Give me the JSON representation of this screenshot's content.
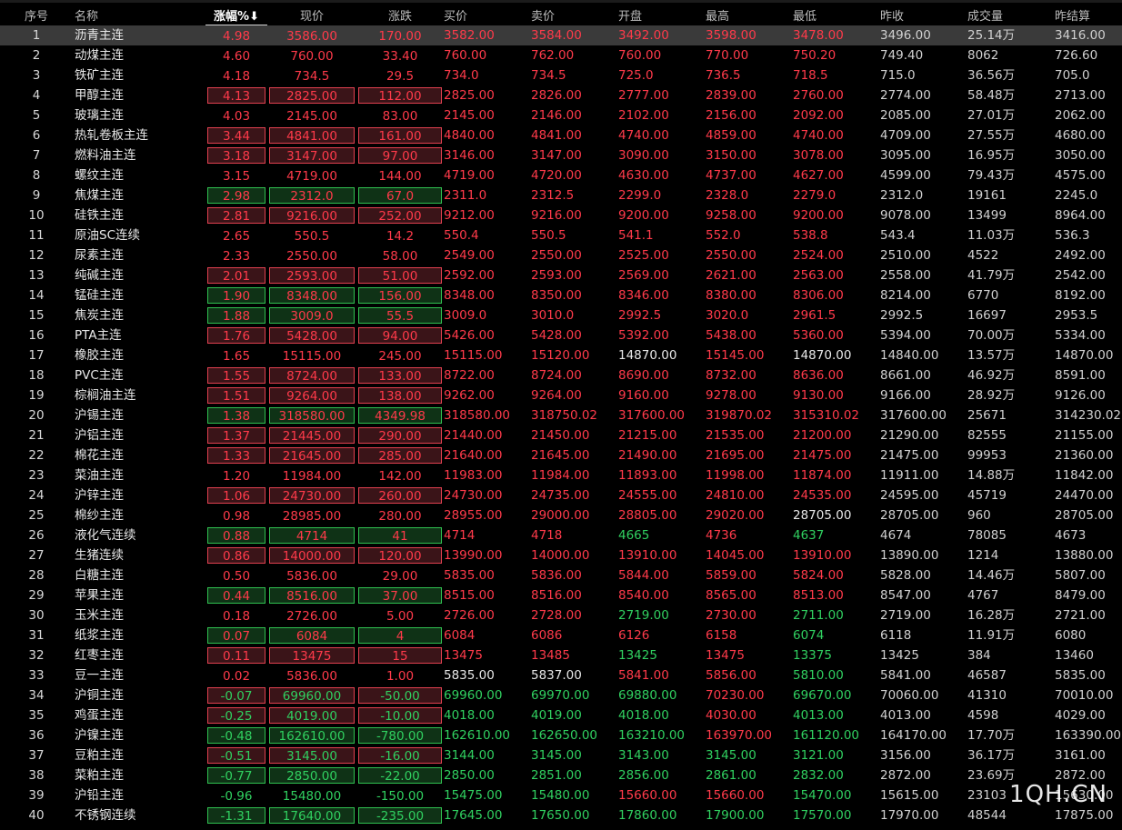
{
  "headers": [
    "序号",
    "名称",
    "涨幅%",
    "现价",
    "涨跌",
    "买价",
    "卖价",
    "开盘",
    "最高",
    "最低",
    "昨收",
    "成交量",
    "昨结算"
  ],
  "sort_arrow": "⬇",
  "colors": {
    "up": "#ff3a4a",
    "down": "#30d060",
    "flat": "#e8e8e8",
    "neutral": "#d0d0d0"
  },
  "watermark": "1QH.CN",
  "rows": [
    {
      "i": "1",
      "n": "沥青主连",
      "p": "4.98",
      "c": "3586.00",
      "d": "170.00",
      "b": "3582.00",
      "s": "3584.00",
      "o": "3492.00",
      "h": "3598.00",
      "l": "3478.00",
      "y": "3496.00",
      "v": "25.14万",
      "z": "3416.00",
      "box": "none",
      "cb": "up",
      "co": "up",
      "ch": "up",
      "cl": "up",
      "selected": true
    },
    {
      "i": "2",
      "n": "动煤主连",
      "p": "4.60",
      "c": "760.00",
      "d": "33.40",
      "b": "760.00",
      "s": "762.00",
      "o": "760.00",
      "h": "770.00",
      "l": "750.20",
      "y": "749.40",
      "v": "8062",
      "z": "726.60",
      "box": "none",
      "cb": "up",
      "co": "up",
      "ch": "up",
      "cl": "up"
    },
    {
      "i": "3",
      "n": "铁矿主连",
      "p": "4.18",
      "c": "734.5",
      "d": "29.5",
      "b": "734.0",
      "s": "734.5",
      "o": "725.0",
      "h": "736.5",
      "l": "718.5",
      "y": "715.0",
      "v": "36.56万",
      "z": "705.0",
      "box": "none",
      "cb": "up",
      "co": "up",
      "ch": "up",
      "cl": "up"
    },
    {
      "i": "4",
      "n": "甲醇主连",
      "p": "4.13",
      "c": "2825.00",
      "d": "112.00",
      "b": "2825.00",
      "s": "2826.00",
      "o": "2777.00",
      "h": "2839.00",
      "l": "2760.00",
      "y": "2774.00",
      "v": "58.48万",
      "z": "2713.00",
      "box": "red",
      "cb": "up",
      "co": "up",
      "ch": "up",
      "cl": "up"
    },
    {
      "i": "5",
      "n": "玻璃主连",
      "p": "4.03",
      "c": "2145.00",
      "d": "83.00",
      "b": "2145.00",
      "s": "2146.00",
      "o": "2102.00",
      "h": "2156.00",
      "l": "2092.00",
      "y": "2085.00",
      "v": "27.01万",
      "z": "2062.00",
      "box": "none",
      "cb": "up",
      "co": "up",
      "ch": "up",
      "cl": "up"
    },
    {
      "i": "6",
      "n": "热轧卷板主连",
      "p": "3.44",
      "c": "4841.00",
      "d": "161.00",
      "b": "4840.00",
      "s": "4841.00",
      "o": "4740.00",
      "h": "4859.00",
      "l": "4740.00",
      "y": "4709.00",
      "v": "27.55万",
      "z": "4680.00",
      "box": "red",
      "cb": "up",
      "co": "up",
      "ch": "up",
      "cl": "up"
    },
    {
      "i": "7",
      "n": "燃料油主连",
      "p": "3.18",
      "c": "3147.00",
      "d": "97.00",
      "b": "3146.00",
      "s": "3147.00",
      "o": "3090.00",
      "h": "3150.00",
      "l": "3078.00",
      "y": "3095.00",
      "v": "16.95万",
      "z": "3050.00",
      "box": "red",
      "cb": "up",
      "co": "up",
      "ch": "up",
      "cl": "up"
    },
    {
      "i": "8",
      "n": "螺纹主连",
      "p": "3.15",
      "c": "4719.00",
      "d": "144.00",
      "b": "4719.00",
      "s": "4720.00",
      "o": "4630.00",
      "h": "4737.00",
      "l": "4627.00",
      "y": "4599.00",
      "v": "79.43万",
      "z": "4575.00",
      "box": "none",
      "cb": "up",
      "co": "up",
      "ch": "up",
      "cl": "up"
    },
    {
      "i": "9",
      "n": "焦煤主连",
      "p": "2.98",
      "c": "2312.0",
      "d": "67.0",
      "b": "2311.0",
      "s": "2312.5",
      "o": "2299.0",
      "h": "2328.0",
      "l": "2279.0",
      "y": "2312.0",
      "v": "19161",
      "z": "2245.0",
      "box": "green",
      "cb": "up",
      "co": "up",
      "ch": "up",
      "cl": "up"
    },
    {
      "i": "10",
      "n": "硅铁主连",
      "p": "2.81",
      "c": "9216.00",
      "d": "252.00",
      "b": "9212.00",
      "s": "9216.00",
      "o": "9200.00",
      "h": "9258.00",
      "l": "9200.00",
      "y": "9078.00",
      "v": "13499",
      "z": "8964.00",
      "box": "red",
      "cb": "up",
      "co": "up",
      "ch": "up",
      "cl": "up"
    },
    {
      "i": "11",
      "n": "原油SC连续",
      "p": "2.65",
      "c": "550.5",
      "d": "14.2",
      "b": "550.4",
      "s": "550.5",
      "o": "541.1",
      "h": "552.0",
      "l": "538.8",
      "y": "543.4",
      "v": "11.03万",
      "z": "536.3",
      "box": "none",
      "cb": "up",
      "co": "up",
      "ch": "up",
      "cl": "up"
    },
    {
      "i": "12",
      "n": "尿素主连",
      "p": "2.33",
      "c": "2550.00",
      "d": "58.00",
      "b": "2549.00",
      "s": "2550.00",
      "o": "2525.00",
      "h": "2550.00",
      "l": "2524.00",
      "y": "2510.00",
      "v": "4522",
      "z": "2492.00",
      "box": "none",
      "cb": "up",
      "co": "up",
      "ch": "up",
      "cl": "up"
    },
    {
      "i": "13",
      "n": "纯碱主连",
      "p": "2.01",
      "c": "2593.00",
      "d": "51.00",
      "b": "2592.00",
      "s": "2593.00",
      "o": "2569.00",
      "h": "2621.00",
      "l": "2563.00",
      "y": "2558.00",
      "v": "41.79万",
      "z": "2542.00",
      "box": "red",
      "cb": "up",
      "co": "up",
      "ch": "up",
      "cl": "up"
    },
    {
      "i": "14",
      "n": "锰硅主连",
      "p": "1.90",
      "c": "8348.00",
      "d": "156.00",
      "b": "8348.00",
      "s": "8350.00",
      "o": "8346.00",
      "h": "8380.00",
      "l": "8306.00",
      "y": "8214.00",
      "v": "6770",
      "z": "8192.00",
      "box": "green",
      "cb": "up",
      "co": "up",
      "ch": "up",
      "cl": "up"
    },
    {
      "i": "15",
      "n": "焦炭主连",
      "p": "1.88",
      "c": "3009.0",
      "d": "55.5",
      "b": "3009.0",
      "s": "3010.0",
      "o": "2992.5",
      "h": "3020.0",
      "l": "2961.5",
      "y": "2992.5",
      "v": "16697",
      "z": "2953.5",
      "box": "green",
      "cb": "up",
      "co": "up",
      "ch": "up",
      "cl": "up"
    },
    {
      "i": "16",
      "n": "PTA主连",
      "p": "1.76",
      "c": "5428.00",
      "d": "94.00",
      "b": "5426.00",
      "s": "5428.00",
      "o": "5392.00",
      "h": "5438.00",
      "l": "5360.00",
      "y": "5394.00",
      "v": "70.00万",
      "z": "5334.00",
      "box": "red",
      "cb": "up",
      "co": "up",
      "ch": "up",
      "cl": "up"
    },
    {
      "i": "17",
      "n": "橡胶主连",
      "p": "1.65",
      "c": "15115.00",
      "d": "245.00",
      "b": "15115.00",
      "s": "15120.00",
      "o": "14870.00",
      "h": "15145.00",
      "l": "14870.00",
      "y": "14840.00",
      "v": "13.57万",
      "z": "14870.00",
      "box": "none",
      "cb": "up",
      "co": "flat",
      "ch": "up",
      "cl": "flat"
    },
    {
      "i": "18",
      "n": "PVC主连",
      "p": "1.55",
      "c": "8724.00",
      "d": "133.00",
      "b": "8722.00",
      "s": "8724.00",
      "o": "8690.00",
      "h": "8732.00",
      "l": "8636.00",
      "y": "8661.00",
      "v": "46.92万",
      "z": "8591.00",
      "box": "red",
      "cb": "up",
      "co": "up",
      "ch": "up",
      "cl": "up"
    },
    {
      "i": "19",
      "n": "棕榈油主连",
      "p": "1.51",
      "c": "9264.00",
      "d": "138.00",
      "b": "9262.00",
      "s": "9264.00",
      "o": "9160.00",
      "h": "9278.00",
      "l": "9130.00",
      "y": "9166.00",
      "v": "28.92万",
      "z": "9126.00",
      "box": "red",
      "cb": "up",
      "co": "up",
      "ch": "up",
      "cl": "up"
    },
    {
      "i": "20",
      "n": "沪锡主连",
      "p": "1.38",
      "c": "318580.00",
      "d": "4349.98",
      "b": "318580.00",
      "s": "318750.02",
      "o": "317600.00",
      "h": "319870.02",
      "l": "315310.02",
      "y": "317600.00",
      "v": "25671",
      "z": "314230.02",
      "box": "green",
      "cb": "up",
      "co": "up",
      "ch": "up",
      "cl": "up"
    },
    {
      "i": "21",
      "n": "沪铝主连",
      "p": "1.37",
      "c": "21445.00",
      "d": "290.00",
      "b": "21440.00",
      "s": "21450.00",
      "o": "21215.00",
      "h": "21535.00",
      "l": "21200.00",
      "y": "21290.00",
      "v": "82555",
      "z": "21155.00",
      "box": "red",
      "cb": "up",
      "co": "up",
      "ch": "up",
      "cl": "up"
    },
    {
      "i": "22",
      "n": "棉花主连",
      "p": "1.33",
      "c": "21645.00",
      "d": "285.00",
      "b": "21640.00",
      "s": "21645.00",
      "o": "21490.00",
      "h": "21695.00",
      "l": "21475.00",
      "y": "21475.00",
      "v": "99953",
      "z": "21360.00",
      "box": "red",
      "cb": "up",
      "co": "up",
      "ch": "up",
      "cl": "up"
    },
    {
      "i": "23",
      "n": "菜油主连",
      "p": "1.20",
      "c": "11984.00",
      "d": "142.00",
      "b": "11983.00",
      "s": "11984.00",
      "o": "11893.00",
      "h": "11998.00",
      "l": "11874.00",
      "y": "11911.00",
      "v": "14.88万",
      "z": "11842.00",
      "box": "none",
      "cb": "up",
      "co": "up",
      "ch": "up",
      "cl": "up"
    },
    {
      "i": "24",
      "n": "沪锌主连",
      "p": "1.06",
      "c": "24730.00",
      "d": "260.00",
      "b": "24730.00",
      "s": "24735.00",
      "o": "24555.00",
      "h": "24810.00",
      "l": "24535.00",
      "y": "24595.00",
      "v": "45719",
      "z": "24470.00",
      "box": "red",
      "cb": "up",
      "co": "up",
      "ch": "up",
      "cl": "up"
    },
    {
      "i": "25",
      "n": "棉纱主连",
      "p": "0.98",
      "c": "28985.00",
      "d": "280.00",
      "b": "28955.00",
      "s": "29000.00",
      "o": "28805.00",
      "h": "29020.00",
      "l": "28705.00",
      "y": "28705.00",
      "v": "960",
      "z": "28705.00",
      "box": "none",
      "cb": "up",
      "co": "up",
      "ch": "up",
      "cl": "flat"
    },
    {
      "i": "26",
      "n": "液化气连续",
      "p": "0.88",
      "c": "4714",
      "d": "41",
      "b": "4714",
      "s": "4718",
      "o": "4665",
      "h": "4736",
      "l": "4637",
      "y": "4674",
      "v": "78085",
      "z": "4673",
      "box": "green",
      "cb": "up",
      "co": "down",
      "ch": "up",
      "cl": "down"
    },
    {
      "i": "27",
      "n": "生猪连续",
      "p": "0.86",
      "c": "14000.00",
      "d": "120.00",
      "b": "13990.00",
      "s": "14000.00",
      "o": "13910.00",
      "h": "14045.00",
      "l": "13910.00",
      "y": "13890.00",
      "v": "1214",
      "z": "13880.00",
      "box": "red",
      "cb": "up",
      "co": "up",
      "ch": "up",
      "cl": "up"
    },
    {
      "i": "28",
      "n": "白糖主连",
      "p": "0.50",
      "c": "5836.00",
      "d": "29.00",
      "b": "5835.00",
      "s": "5836.00",
      "o": "5844.00",
      "h": "5859.00",
      "l": "5824.00",
      "y": "5828.00",
      "v": "14.46万",
      "z": "5807.00",
      "box": "none",
      "cb": "up",
      "co": "up",
      "ch": "up",
      "cl": "up"
    },
    {
      "i": "29",
      "n": "苹果主连",
      "p": "0.44",
      "c": "8516.00",
      "d": "37.00",
      "b": "8515.00",
      "s": "8516.00",
      "o": "8540.00",
      "h": "8565.00",
      "l": "8513.00",
      "y": "8547.00",
      "v": "4767",
      "z": "8479.00",
      "box": "green",
      "cb": "up",
      "co": "up",
      "ch": "up",
      "cl": "up"
    },
    {
      "i": "30",
      "n": "玉米主连",
      "p": "0.18",
      "c": "2726.00",
      "d": "5.00",
      "b": "2726.00",
      "s": "2728.00",
      "o": "2719.00",
      "h": "2730.00",
      "l": "2711.00",
      "y": "2719.00",
      "v": "16.28万",
      "z": "2721.00",
      "box": "none",
      "cb": "up",
      "co": "down",
      "ch": "up",
      "cl": "down"
    },
    {
      "i": "31",
      "n": "纸浆主连",
      "p": "0.07",
      "c": "6084",
      "d": "4",
      "b": "6084",
      "s": "6086",
      "o": "6126",
      "h": "6158",
      "l": "6074",
      "y": "6118",
      "v": "11.91万",
      "z": "6080",
      "box": "green",
      "cb": "up",
      "co": "up",
      "ch": "up",
      "cl": "down"
    },
    {
      "i": "32",
      "n": "红枣主连",
      "p": "0.11",
      "c": "13475",
      "d": "15",
      "b": "13475",
      "s": "13485",
      "o": "13425",
      "h": "13475",
      "l": "13375",
      "y": "13425",
      "v": "384",
      "z": "13460",
      "box": "red",
      "cb": "up",
      "co": "down",
      "ch": "up",
      "cl": "down"
    },
    {
      "i": "33",
      "n": "豆一主连",
      "p": "0.02",
      "c": "5836.00",
      "d": "1.00",
      "b": "5835.00",
      "s": "5837.00",
      "o": "5841.00",
      "h": "5856.00",
      "l": "5810.00",
      "y": "5841.00",
      "v": "46587",
      "z": "5835.00",
      "box": "none",
      "cb": "flat",
      "co": "up",
      "ch": "up",
      "cl": "down"
    },
    {
      "i": "34",
      "n": "沪铜主连",
      "p": "-0.07",
      "c": "69960.00",
      "d": "-50.00",
      "b": "69960.00",
      "s": "69970.00",
      "o": "69880.00",
      "h": "70230.00",
      "l": "69670.00",
      "y": "70060.00",
      "v": "41310",
      "z": "70010.00",
      "box": "red",
      "cb": "down",
      "co": "down",
      "ch": "up",
      "cl": "down"
    },
    {
      "i": "35",
      "n": "鸡蛋主连",
      "p": "-0.25",
      "c": "4019.00",
      "d": "-10.00",
      "b": "4018.00",
      "s": "4019.00",
      "o": "4018.00",
      "h": "4030.00",
      "l": "4013.00",
      "y": "4013.00",
      "v": "4598",
      "z": "4029.00",
      "box": "red",
      "cb": "down",
      "co": "down",
      "ch": "up",
      "cl": "down"
    },
    {
      "i": "36",
      "n": "沪镍主连",
      "p": "-0.48",
      "c": "162610.00",
      "d": "-780.00",
      "b": "162610.00",
      "s": "162650.00",
      "o": "163210.00",
      "h": "163970.00",
      "l": "161120.00",
      "y": "164170.00",
      "v": "17.70万",
      "z": "163390.00",
      "box": "green",
      "cb": "down",
      "co": "down",
      "ch": "up",
      "cl": "down"
    },
    {
      "i": "37",
      "n": "豆粕主连",
      "p": "-0.51",
      "c": "3145.00",
      "d": "-16.00",
      "b": "3144.00",
      "s": "3145.00",
      "o": "3143.00",
      "h": "3145.00",
      "l": "3121.00",
      "y": "3156.00",
      "v": "36.17万",
      "z": "3161.00",
      "box": "red",
      "cb": "down",
      "co": "down",
      "ch": "down",
      "cl": "down"
    },
    {
      "i": "38",
      "n": "菜粕主连",
      "p": "-0.77",
      "c": "2850.00",
      "d": "-22.00",
      "b": "2850.00",
      "s": "2851.00",
      "o": "2856.00",
      "h": "2861.00",
      "l": "2832.00",
      "y": "2872.00",
      "v": "23.69万",
      "z": "2872.00",
      "box": "green",
      "cb": "down",
      "co": "down",
      "ch": "down",
      "cl": "down"
    },
    {
      "i": "39",
      "n": "沪铅主连",
      "p": "-0.96",
      "c": "15480.00",
      "d": "-150.00",
      "b": "15475.00",
      "s": "15480.00",
      "o": "15660.00",
      "h": "15660.00",
      "l": "15470.00",
      "y": "15615.00",
      "v": "23103",
      "z": "15630.00",
      "box": "none",
      "cb": "down",
      "co": "up",
      "ch": "up",
      "cl": "down"
    },
    {
      "i": "40",
      "n": "不锈钢连续",
      "p": "-1.31",
      "c": "17640.00",
      "d": "-235.00",
      "b": "17645.00",
      "s": "17650.00",
      "o": "17860.00",
      "h": "17900.00",
      "l": "17570.00",
      "y": "17970.00",
      "v": "48544",
      "z": "17875.00",
      "box": "green",
      "cb": "down",
      "co": "down",
      "ch": "down",
      "cl": "down"
    }
  ]
}
